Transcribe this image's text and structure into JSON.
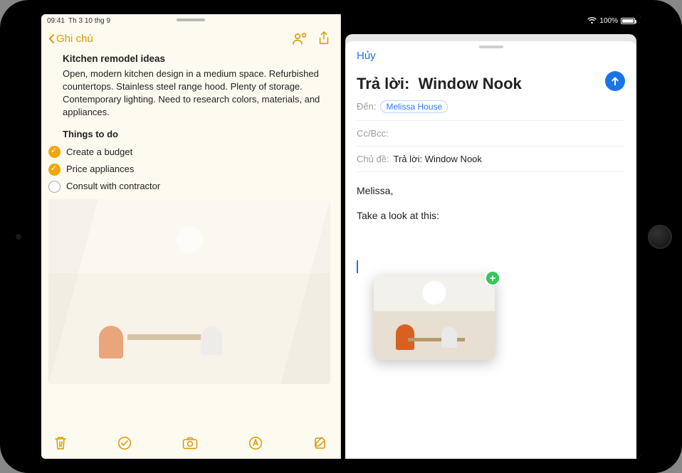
{
  "status": {
    "time": "09:41",
    "date": "Th 3 10 thg 9",
    "battery": "100%"
  },
  "notes": {
    "back_label": "Ghi chú",
    "title": "Kitchen remodel ideas",
    "description": "Open, modern kitchen design in a medium space. Refurbished countertops. Stainless steel range hood. Plenty of storage. Contemporary lighting. Need to research colors, materials, and appliances.",
    "todo_heading": "Things to do",
    "todos": [
      {
        "label": "Create a budget",
        "checked": true
      },
      {
        "label": "Price appliances",
        "checked": true
      },
      {
        "label": "Consult with contractor",
        "checked": false
      }
    ]
  },
  "mail": {
    "cancel_label": "Hủy",
    "reply_prefix": "Trả lời:",
    "subject_title": "Window Nook",
    "to_label": "Đến:",
    "to_recipient": "Melissa House",
    "ccbcc_label": "Cc/Bcc:",
    "subject_label": "Chủ đề:",
    "subject_value": "Trả lời:  Window Nook",
    "body_line1": "Melissa,",
    "body_line2": "Take a look at this:"
  },
  "colors": {
    "notes_tint": "#e19b00",
    "mail_tint": "#1a73e8",
    "add_badge": "#34c759"
  }
}
